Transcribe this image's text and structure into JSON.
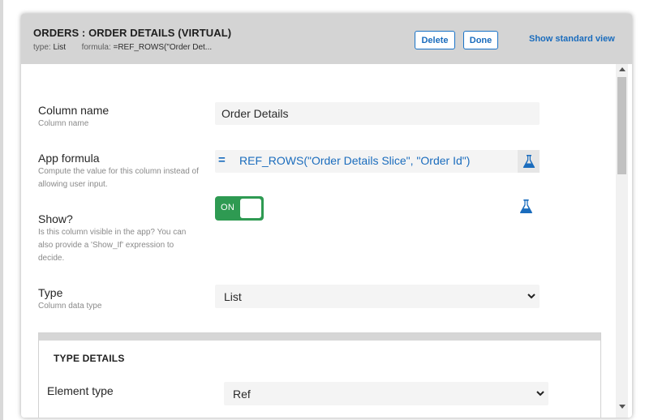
{
  "header": {
    "title": "ORDERS : ORDER DETAILS (VIRTUAL)",
    "type_label": "type:",
    "type_value": "List",
    "formula_label": "formula:",
    "formula_value": "=REF_ROWS(\"Order Det...",
    "delete_label": "Delete",
    "done_label": "Done",
    "standard_view_label": "Show standard view"
  },
  "fields": {
    "column_name": {
      "label": "Column name",
      "help": "Column name",
      "value": "Order Details"
    },
    "app_formula": {
      "label": "App formula",
      "help": "Compute the value for this column instead of allowing user input.",
      "eq": "=",
      "value": "REF_ROWS(\"Order Details Slice\", \"Order Id\")",
      "icon": "flask-icon"
    },
    "show": {
      "label": "Show?",
      "help": "Is this column visible in the app? You can also provide a 'Show_If' expression to decide.",
      "toggle_label": "ON",
      "state": "on",
      "icon": "flask-icon"
    },
    "type": {
      "label": "Type",
      "help": "Column data type",
      "value": "List"
    }
  },
  "type_details": {
    "title": "TYPE DETAILS",
    "element_type_label": "Element type",
    "element_type_value": "Ref"
  },
  "colors": {
    "accent": "#1a6cbd",
    "toggle_on": "#2e9a52",
    "header_bg": "#d4d4d4"
  }
}
